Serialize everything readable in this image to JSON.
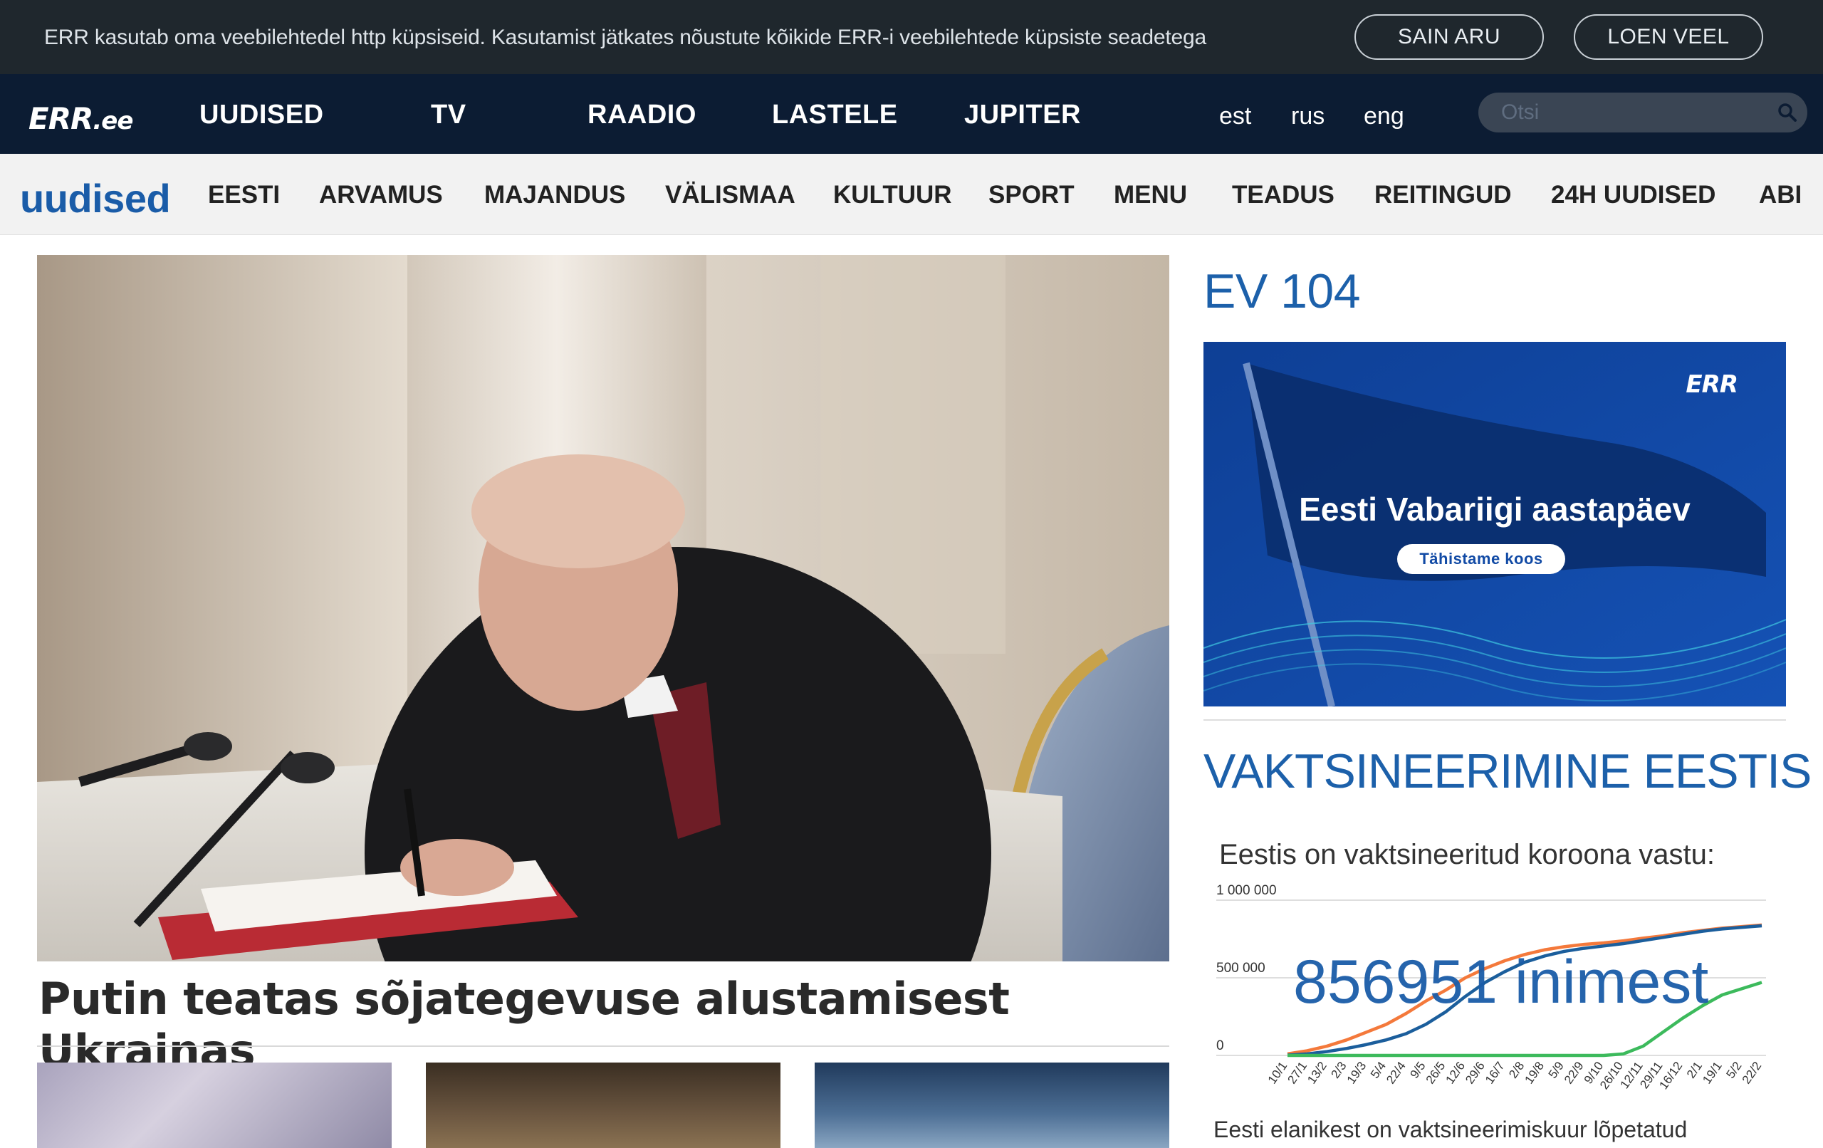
{
  "cookie_bar": {
    "text": "ERR kasutab oma veebilehtedel http küpsiseid. Kasutamist jätkates nõustute kõikide ERR-i veebilehtede küpsiste seadetega",
    "accept_label": "SAIN ARU",
    "more_label": "LOEN VEEL"
  },
  "header": {
    "logo_main": "ERR",
    "logo_suffix": ".ee",
    "nav": [
      "UUDISED",
      "TV",
      "RAADIO",
      "LASTELE",
      "JUPITER"
    ],
    "languages": [
      "est",
      "rus",
      "eng"
    ],
    "search_placeholder": "Otsi"
  },
  "subnav": {
    "brand": "uudised",
    "items": [
      "EESTI",
      "ARVAMUS",
      "MAJANDUS",
      "VÄLISMAA",
      "KULTUUR",
      "SPORT",
      "MENU",
      "TEADUS",
      "REITINGUD",
      "24H UUDISED",
      "ABI"
    ]
  },
  "main": {
    "hero_title": "Putin teatas sõjategevuse alustamisest Ukrainas"
  },
  "sidebar": {
    "ev_heading": "EV 104",
    "banner_logo": "ERR",
    "banner_title": "Eesti Vabariigi aastapäev",
    "banner_button": "Tähistame koos",
    "vacc_heading": "VAKTSINEERIMINE EESTIS",
    "vacc_subheading": "Eestis on vaktsineeritud koroona vastu:",
    "vacc_overlay": "856951 inimest",
    "vacc_footer": "Eesti elanikest on vaktsineerimiskuur lõpetatud"
  },
  "chart_data": {
    "type": "line",
    "yticks": [
      "1 000 000",
      "500 000",
      "0"
    ],
    "ylim": [
      0,
      1000000
    ],
    "categories": [
      "10/1",
      "27/1",
      "13/2",
      "2/3",
      "19/3",
      "5/4",
      "22/4",
      "9/5",
      "26/5",
      "12/6",
      "29/6",
      "16/7",
      "2/8",
      "19/8",
      "5/9",
      "22/9",
      "9/10",
      "26/10",
      "12/11",
      "29/11",
      "16/12",
      "2/1",
      "19/1",
      "5/2",
      "22/2"
    ],
    "series": [
      {
        "color": "#f4793b",
        "values": [
          10000,
          30000,
          60000,
          100000,
          150000,
          200000,
          270000,
          350000,
          420000,
          500000,
          560000,
          610000,
          650000,
          680000,
          700000,
          715000,
          725000,
          738000,
          755000,
          770000,
          790000,
          805000,
          820000,
          830000,
          840000
        ]
      },
      {
        "color": "#1b5e9c",
        "values": [
          2000,
          10000,
          25000,
          45000,
          70000,
          100000,
          140000,
          200000,
          280000,
          380000,
          470000,
          540000,
          600000,
          640000,
          670000,
          690000,
          705000,
          720000,
          740000,
          760000,
          780000,
          800000,
          815000,
          825000,
          835000
        ]
      },
      {
        "color": "#3cba5c",
        "values": [
          0,
          0,
          0,
          0,
          0,
          0,
          0,
          0,
          0,
          0,
          0,
          0,
          0,
          0,
          0,
          0,
          0,
          10000,
          60000,
          150000,
          240000,
          320000,
          390000,
          430000,
          470000
        ]
      }
    ]
  }
}
